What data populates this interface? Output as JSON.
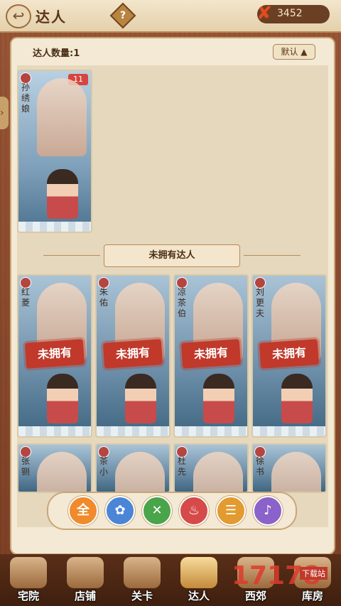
{
  "top": {
    "title": "达人",
    "help": "?",
    "currency": "3452"
  },
  "panel": {
    "count_label": "达人数量:1",
    "sort_label": "默认"
  },
  "owned": [
    {
      "name": "孙绣娘",
      "level": "11"
    }
  ],
  "divider_label": "未拥有达人",
  "unowned_stamp": "未拥有",
  "unowned_row1": [
    {
      "name": "红菱"
    },
    {
      "name": "朱佑"
    },
    {
      "name": "凉茶伯"
    },
    {
      "name": "刘更夫"
    }
  ],
  "unowned_row2": [
    {
      "name": "张铡"
    },
    {
      "name": "茶小"
    },
    {
      "name": "杜先"
    },
    {
      "name": "徐书"
    }
  ],
  "filters": [
    {
      "label": "全",
      "color": "#f08a2b"
    },
    {
      "label": "✿",
      "color": "#4b86d6"
    },
    {
      "label": "✕",
      "color": "#4aa44a"
    },
    {
      "label": "♨",
      "color": "#d64a4a"
    },
    {
      "label": "☰",
      "color": "#e39a2f"
    },
    {
      "label": "♪",
      "color": "#8b62c9"
    }
  ],
  "nav": [
    {
      "label": "宅院"
    },
    {
      "label": "店铺"
    },
    {
      "label": "关卡"
    },
    {
      "label": "达人"
    },
    {
      "label": "西郊"
    },
    {
      "label": "库房"
    }
  ],
  "watermark": {
    "brand": "17178",
    "tag": "下载站"
  }
}
